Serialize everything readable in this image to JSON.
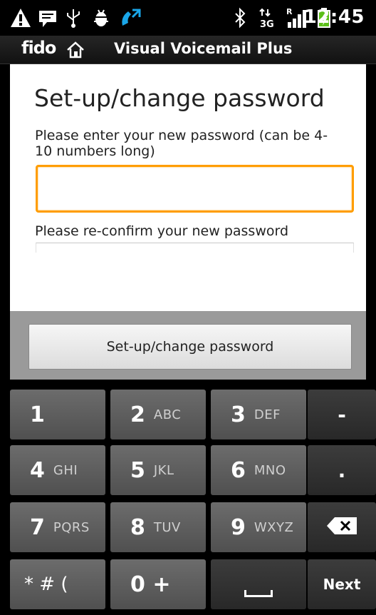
{
  "status_bar": {
    "time": "12:45",
    "icons": [
      "warning-icon",
      "message-icon",
      "usb-icon",
      "android-debug-icon",
      "call-forward-icon",
      "bluetooth-icon",
      "3g-data-icon",
      "signal-icon",
      "battery-charging-icon"
    ]
  },
  "title_bar": {
    "logo": "fido",
    "title": "Visual Voicemail Plus"
  },
  "content": {
    "page_title": "Set-up/change password",
    "instruction": "Please enter your new password (can be 4-10 numbers long)",
    "password_value": "",
    "confirm_label": "Please re-confirm your new password",
    "confirm_value": ""
  },
  "action_button": {
    "label": "Set-up/change password"
  },
  "keyboard": {
    "rows": [
      [
        {
          "digit": "1",
          "letters": ""
        },
        {
          "digit": "2",
          "letters": "ABC"
        },
        {
          "digit": "3",
          "letters": "DEF"
        },
        {
          "func": "-"
        }
      ],
      [
        {
          "digit": "4",
          "letters": "GHI"
        },
        {
          "digit": "5",
          "letters": "JKL"
        },
        {
          "digit": "6",
          "letters": "MNO"
        },
        {
          "func": "."
        }
      ],
      [
        {
          "digit": "7",
          "letters": "PQRS"
        },
        {
          "digit": "8",
          "letters": "TUV"
        },
        {
          "digit": "9",
          "letters": "WXYZ"
        },
        {
          "func": "backspace"
        }
      ],
      [
        {
          "digit": "* # (",
          "letters": ""
        },
        {
          "digit": "0 +",
          "letters": ""
        },
        {
          "func": "space"
        },
        {
          "func": "Next"
        }
      ]
    ]
  },
  "colors": {
    "input_focus": "#ff9d00",
    "background": "#ffffff",
    "keyboard_key": "#5a5a5a"
  }
}
